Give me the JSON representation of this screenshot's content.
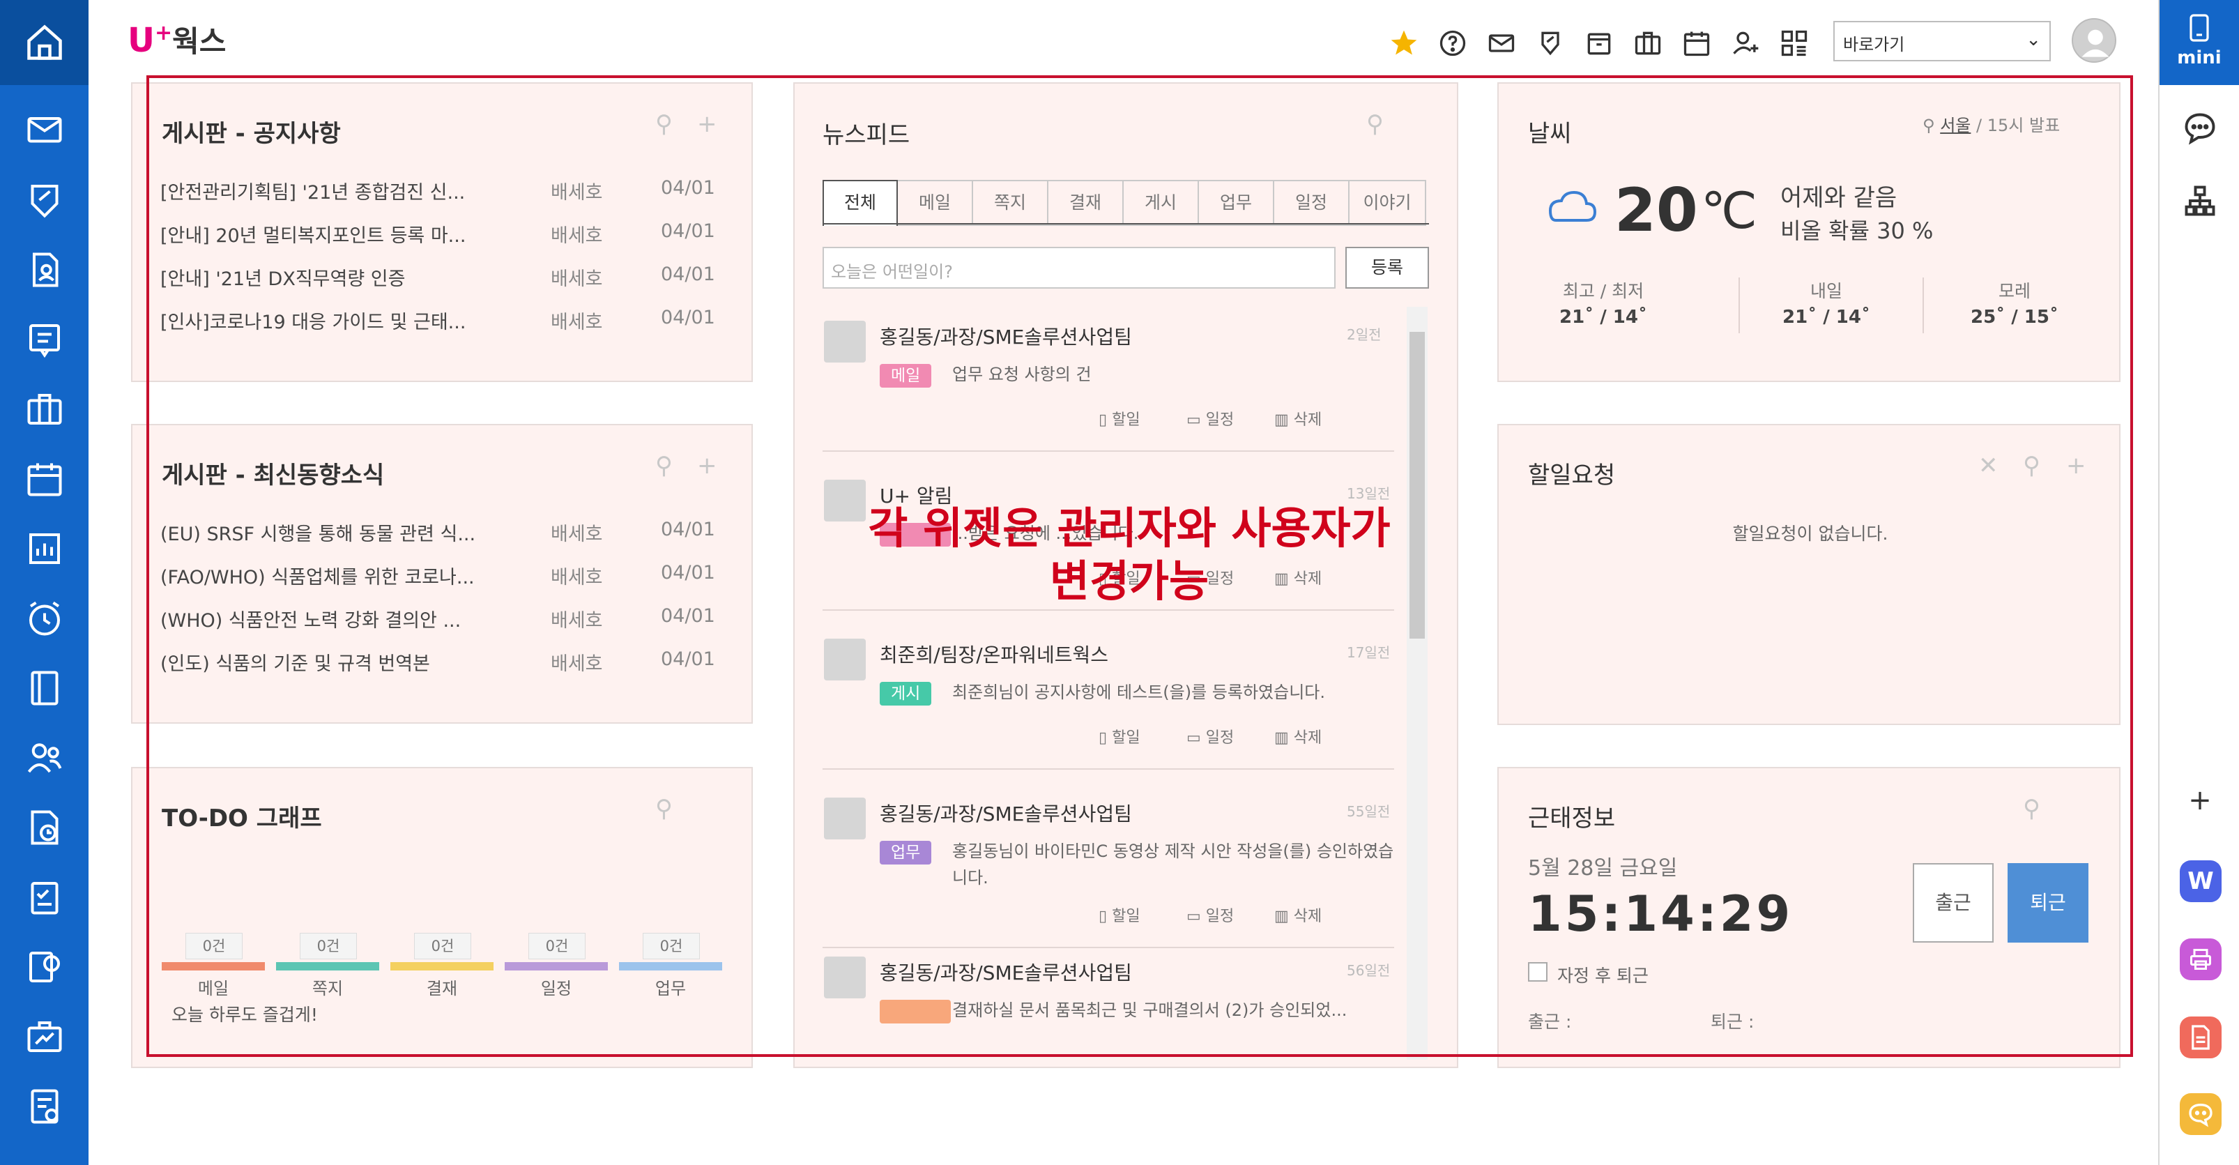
{
  "header": {
    "logo_u": "U",
    "logo_plus": "+",
    "logo_text": "웍스",
    "goto_select": "바로가기"
  },
  "right_rail": {
    "mini_label": "mini"
  },
  "notice_board": {
    "title": "게시판 - 공지사항",
    "rows": [
      {
        "subject": "[안전관리기획팀] '21년 종합검진 신...",
        "author": "배세호",
        "date": "04/01"
      },
      {
        "subject": "[안내] 20년 멀티복지포인트 등록 마...",
        "author": "배세호",
        "date": "04/01"
      },
      {
        "subject": "[안내] '21년 DX직무역량 인증",
        "author": "배세호",
        "date": "04/01"
      },
      {
        "subject": "[인사]코로나19 대응 가이드 및 근태...",
        "author": "배세호",
        "date": "04/01"
      }
    ]
  },
  "trend_board": {
    "title": "게시판 - 최신동향소식",
    "rows": [
      {
        "subject": "(EU) SRSF 시행을 통해 동물 관련 식...",
        "author": "배세호",
        "date": "04/01"
      },
      {
        "subject": "(FAO/WHO) 식품업체를 위한 코로나...",
        "author": "배세호",
        "date": "04/01"
      },
      {
        "subject": "(WHO) 식품안전 노력 강화 결의안 ...",
        "author": "배세호",
        "date": "04/01"
      },
      {
        "subject": "(인도) 식품의 기준 및 규격 번역본",
        "author": "배세호",
        "date": "04/01"
      }
    ]
  },
  "todo_graph": {
    "title": "TO-DO 그래프",
    "items": [
      {
        "label": "메일",
        "count": "0건",
        "color": "#f08a6c"
      },
      {
        "label": "쪽지",
        "count": "0건",
        "color": "#5cc5b3"
      },
      {
        "label": "결재",
        "count": "0건",
        "color": "#f4d060"
      },
      {
        "label": "일정",
        "count": "0건",
        "color": "#b99ad9"
      },
      {
        "label": "업무",
        "count": "0건",
        "color": "#9cc3ec"
      }
    ],
    "footer": "오늘 하루도 즐겁게!"
  },
  "newsfeed": {
    "title": "뉴스피드",
    "tabs": [
      "전체",
      "메일",
      "쪽지",
      "결재",
      "게시",
      "업무",
      "일정",
      "이야기"
    ],
    "input_placeholder": "오늘은 어떤일이?",
    "register_label": "등록",
    "actions": {
      "todo": "할일",
      "schedule": "일정",
      "delete": "삭제"
    },
    "items": [
      {
        "name": "홍길동/과장/SME솔루션사업팀",
        "time": "2일전",
        "badge": "메일",
        "badge_color": "#f18ab2",
        "text": "업무 요청 사항의 건"
      },
      {
        "name": "U+ 알림",
        "time": "13일전",
        "badge": "",
        "badge_color": "#f18ab2",
        "text": "...받은 요청에 ...었습니다."
      },
      {
        "name": "최준희/팀장/온파워네트웍스",
        "time": "17일전",
        "badge": "게시",
        "badge_color": "#46c9a8",
        "text": "최준희님이 공지사항에 테스트(을)를 등록하였습니다."
      },
      {
        "name": "홍길동/과장/SME솔루션사업팀",
        "time": "55일전",
        "badge": "업무",
        "badge_color": "#a887d6",
        "text": "홍길동님이 바이타민C 동영상 제작 시안 작성을(를) 승인하였습니다."
      },
      {
        "name": "홍길동/과장/SME솔루션사업팀",
        "time": "56일전",
        "badge": "",
        "badge_color": "#f8a77b",
        "text": "결재하실 문서 품목최근 및 구매결의서 (2)가 승인되었..."
      }
    ]
  },
  "overlay_note": {
    "line1": "각 위젯은 관리자와 사용자가",
    "line2": "변경가능"
  },
  "weather": {
    "title": "날씨",
    "location": "서울",
    "issued": "/ 15시 발표",
    "temp": "20",
    "unit": "℃",
    "desc": "어제와 같음",
    "rain": "비올 확률 30 %",
    "cols": [
      {
        "label": "최고 / 최저",
        "value": "21˚ / 14˚"
      },
      {
        "label": "내일",
        "value": "21˚ / 14˚"
      },
      {
        "label": "모레",
        "value": "25˚ / 15˚"
      }
    ]
  },
  "todo_request": {
    "title": "할일요청",
    "empty": "할일요청이 없습니다."
  },
  "attendance": {
    "title": "근태정보",
    "date": "5월 28일 금요일",
    "time": "15:14:29",
    "in_label": "출근",
    "out_label": "퇴근",
    "auto_label": "자정 후 퇴근",
    "in_field": "출근 :",
    "out_field": "퇴근 :"
  }
}
